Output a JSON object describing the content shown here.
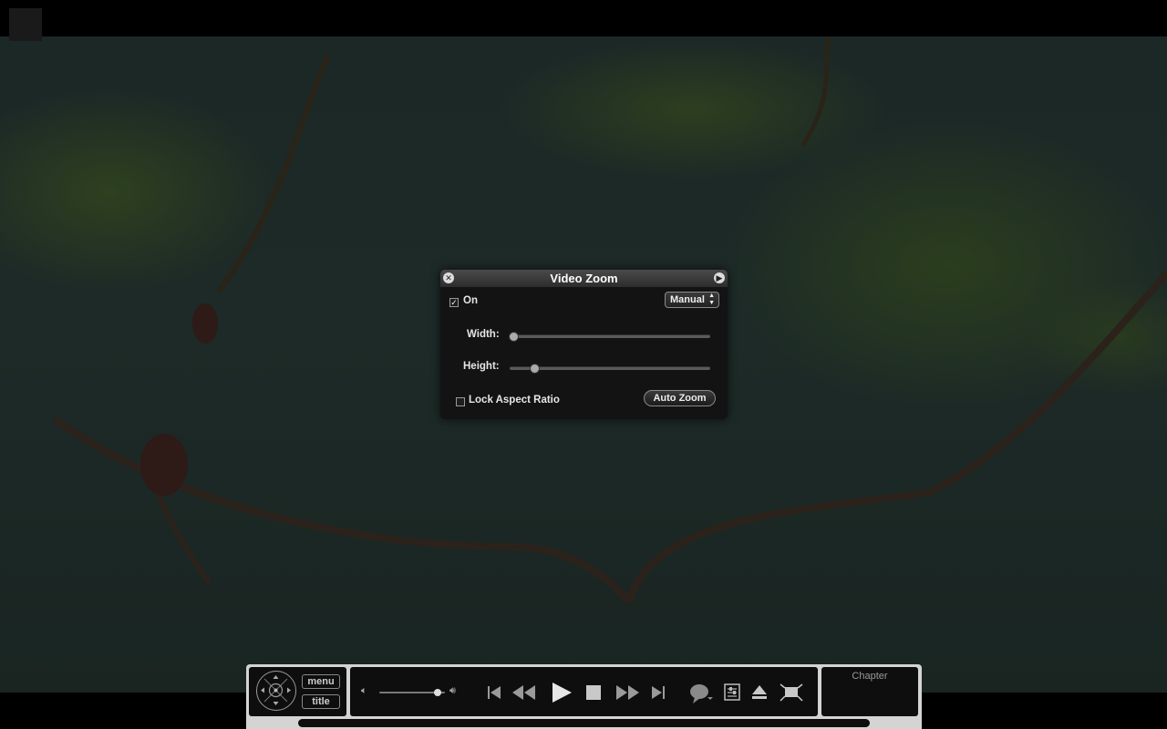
{
  "video_zoom": {
    "title": "Video Zoom",
    "on_label": "On",
    "on_checked": true,
    "mode_value": "Manual",
    "width_label": "Width:",
    "width_fraction": 0.0,
    "height_label": "Height:",
    "height_fraction": 0.11,
    "lock_label": "Lock Aspect Ratio",
    "lock_checked": false,
    "auto_zoom_label": "Auto Zoom"
  },
  "controller": {
    "menu_label": "menu",
    "title_label": "title",
    "volume_fraction": 0.95,
    "chapter_label": "Chapter"
  },
  "icons": {
    "close": "close-icon",
    "advanced": "play-arrow-icon",
    "dpad": "navigation-dpad-icon",
    "volume_low": "speaker-low-icon",
    "volume_high": "speaker-high-icon",
    "previous": "skip-back-icon",
    "rewind": "rewind-icon",
    "play": "play-icon",
    "stop": "stop-icon",
    "fast_forward": "fast-forward-icon",
    "next": "skip-forward-icon",
    "subtitles": "speech-bubble-icon",
    "settings": "sliders-icon",
    "eject": "eject-icon",
    "fullscreen": "fullscreen-icon"
  }
}
